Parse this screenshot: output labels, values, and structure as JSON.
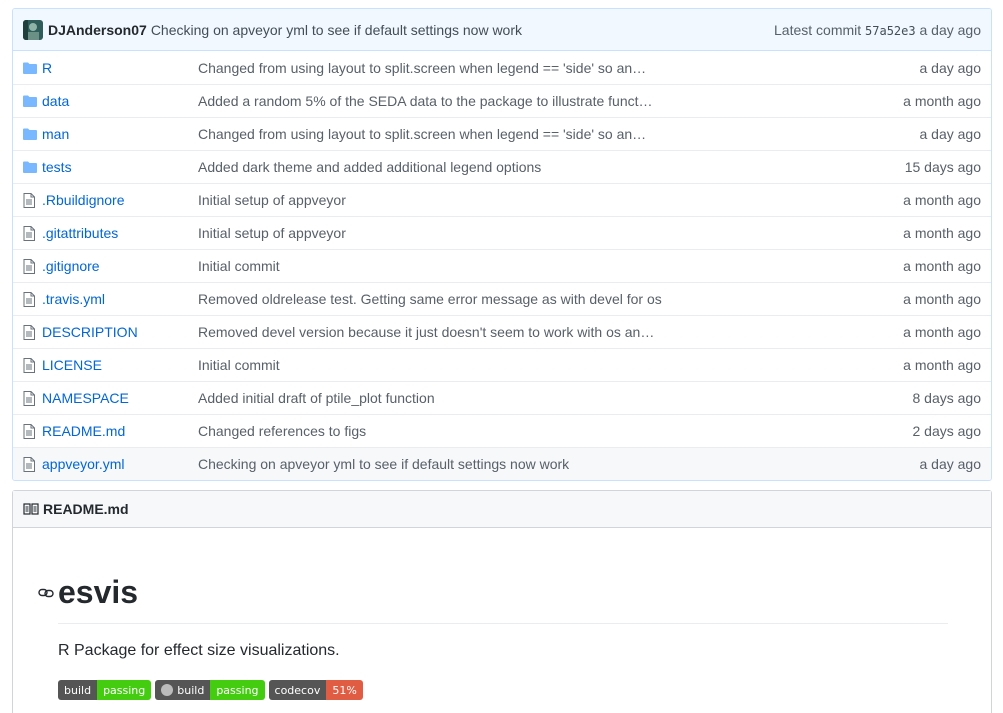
{
  "commit": {
    "author": "DJAnderson07",
    "message": "Checking on apveyor yml to see if default settings now work",
    "latest_label": "Latest commit",
    "sha": "57a52e3",
    "age": "a day ago"
  },
  "files": [
    {
      "name": "R",
      "type": "folder",
      "message": "Changed from using layout to split.screen when legend == 'side' so an…",
      "age": "a day ago"
    },
    {
      "name": "data",
      "type": "folder",
      "message": "Added a random 5% of the SEDA data to the package to illustrate funct…",
      "age": "a month ago"
    },
    {
      "name": "man",
      "type": "folder",
      "message": "Changed from using layout to split.screen when legend == 'side' so an…",
      "age": "a day ago"
    },
    {
      "name": "tests",
      "type": "folder",
      "message": "Added dark theme and added additional legend options",
      "age": "15 days ago"
    },
    {
      "name": ".Rbuildignore",
      "type": "file",
      "message": "Initial setup of appveyor",
      "age": "a month ago"
    },
    {
      "name": ".gitattributes",
      "type": "file",
      "message": "Initial setup of appveyor",
      "age": "a month ago"
    },
    {
      "name": ".gitignore",
      "type": "file",
      "message": "Initial commit",
      "age": "a month ago"
    },
    {
      "name": ".travis.yml",
      "type": "file",
      "message": "Removed oldrelease test. Getting same error message as with devel for os",
      "age": "a month ago"
    },
    {
      "name": "DESCRIPTION",
      "type": "file",
      "message": "Removed devel version because it just doesn't seem to work with os an…",
      "age": "a month ago"
    },
    {
      "name": "LICENSE",
      "type": "file",
      "message": "Initial commit",
      "age": "a month ago"
    },
    {
      "name": "NAMESPACE",
      "type": "file",
      "message": "Added initial draft of ptile_plot function",
      "age": "8 days ago"
    },
    {
      "name": "README.md",
      "type": "file",
      "message": "Changed references to figs",
      "age": "2 days ago"
    },
    {
      "name": "appveyor.yml",
      "type": "file",
      "message": "Checking on apveyor yml to see if default settings now work",
      "age": "a day ago"
    }
  ],
  "readme": {
    "filename": "README.md",
    "title": "esvis",
    "description": "R Package for effect size visualizations.",
    "badges": [
      {
        "left": "build",
        "right": "passing",
        "status": "green",
        "logo": false
      },
      {
        "left": "build",
        "right": "passing",
        "status": "green",
        "logo": true
      },
      {
        "left": "codecov",
        "right": "51%",
        "status": "red",
        "logo": false
      }
    ]
  },
  "colors": {
    "link": "#0366d6",
    "folder": "#79b8ff",
    "badge_green": "#4c1",
    "badge_red": "#e05d44"
  }
}
